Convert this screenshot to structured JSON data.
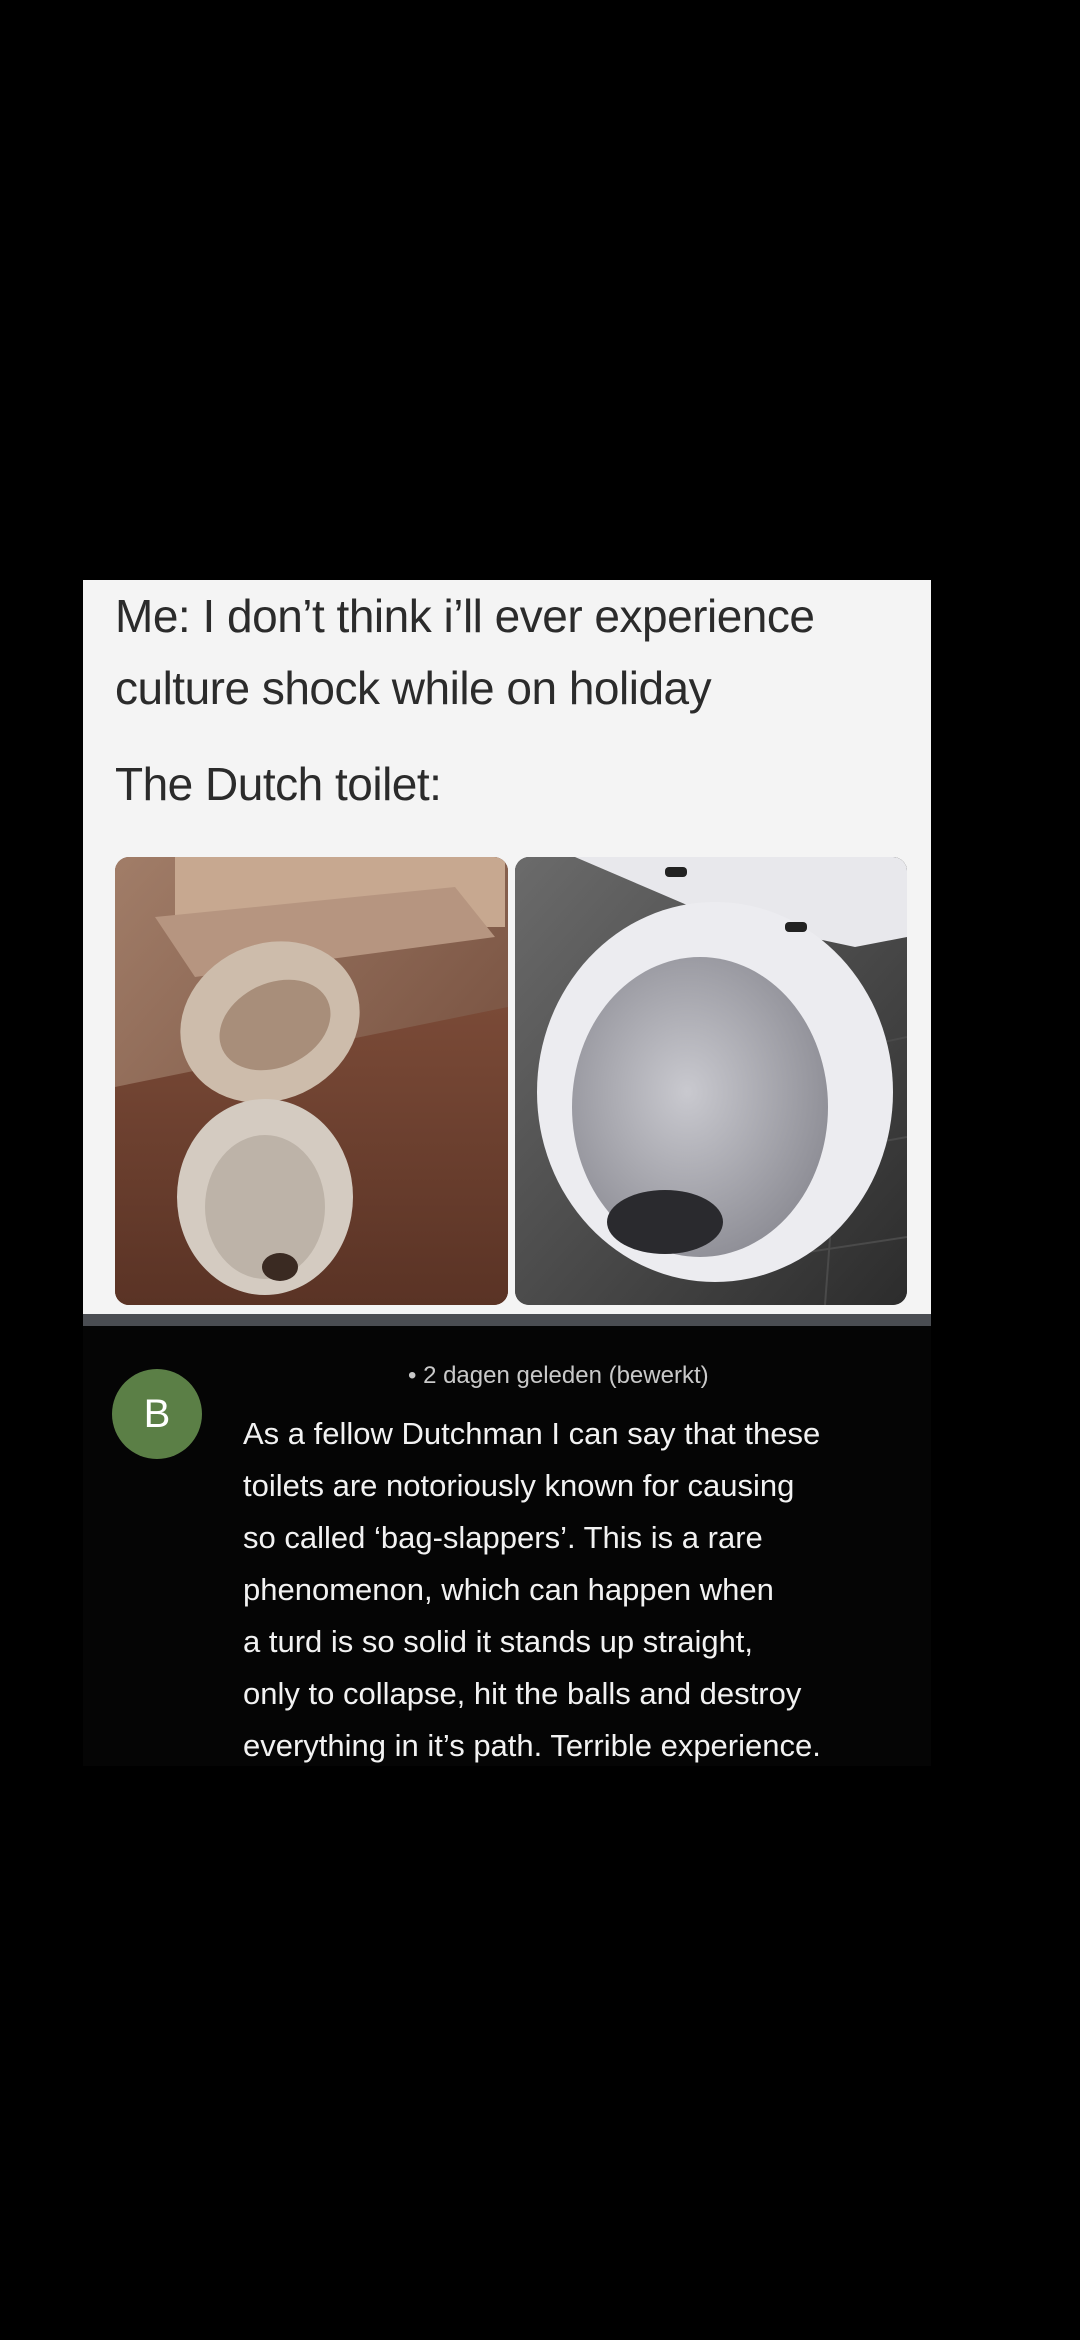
{
  "meme": {
    "line1": "Me: I don’t think i’ll ever experience",
    "line2": "culture shock while on holiday",
    "line3": "The Dutch toilet:"
  },
  "comment": {
    "avatar_letter": "B",
    "avatar_color": "#5b7f46",
    "meta": "• 2 dagen geleden (bewerkt)",
    "lines": [
      "As a fellow Dutchman I can say that these",
      "toilets are notoriously known for causing",
      "so called ‘bag-slappers’. This is a rare",
      "phenomenon, which can happen when",
      "a turd is so solid it stands up straight,",
      "only to collapse, hit the balls and destroy",
      "everything in it’s path. Terrible experience."
    ]
  },
  "colors": {
    "background": "#000000",
    "card": "#f4f4f4",
    "comment_background": "#050505"
  },
  "icons": {
    "photo_left": "toilet-round-bowl-image",
    "photo_right": "toilet-shelf-bowl-image"
  }
}
